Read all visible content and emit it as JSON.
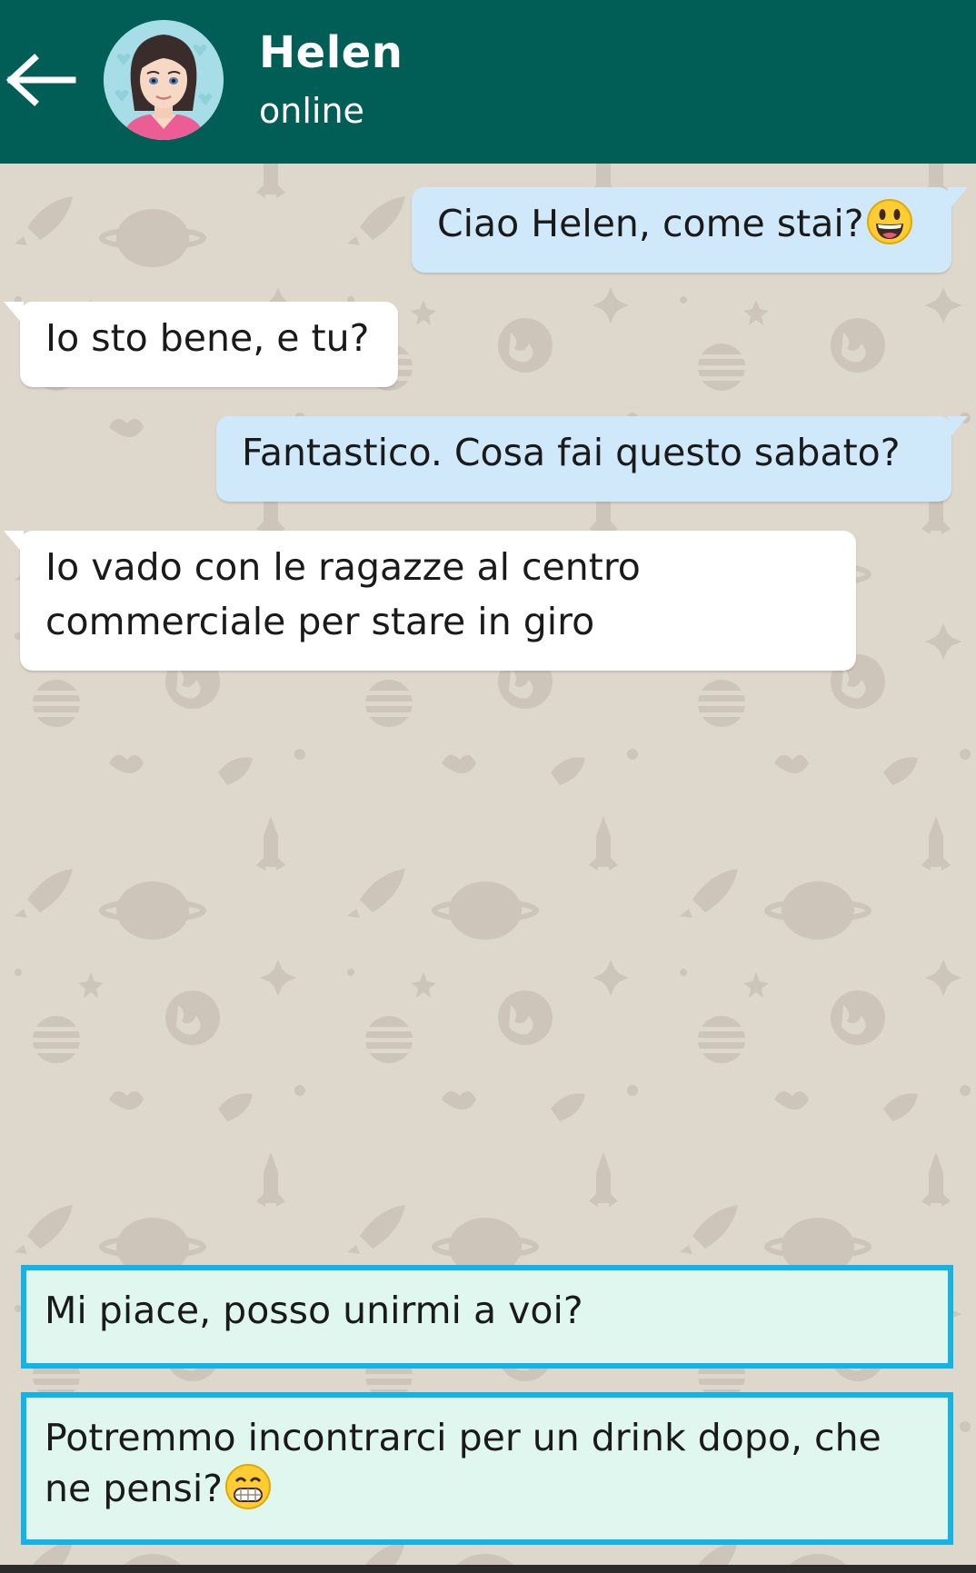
{
  "header": {
    "name": "Helen",
    "status": "online",
    "bg_color": "#005e56"
  },
  "messages": [
    {
      "direction": "outgoing",
      "text": "Ciao Helen, come stai?",
      "emoji": "smiley-face-icon"
    },
    {
      "direction": "incoming",
      "text": "Io sto bene, e tu?"
    },
    {
      "direction": "outgoing",
      "text": "Fantastico. Cosa fai questo sabato?"
    },
    {
      "direction": "incoming",
      "line1": "Io vado con le ragazze al centro",
      "line2": "commerciale per stare in giro"
    }
  ],
  "replies": [
    {
      "text": "Mi piace, posso unirmi a voi?"
    },
    {
      "line1": "Potremmo incontrarci per un drink dopo, che",
      "line2": "ne pensi?",
      "emoji": "grinning-face-icon"
    }
  ],
  "colors": {
    "outgoing_bubble": "#cfe9fb",
    "incoming_bubble": "#ffffff",
    "reply_border": "#12b3e6",
    "reply_bg": "#e0f7ef",
    "wallpaper": "#ddd7cc"
  }
}
